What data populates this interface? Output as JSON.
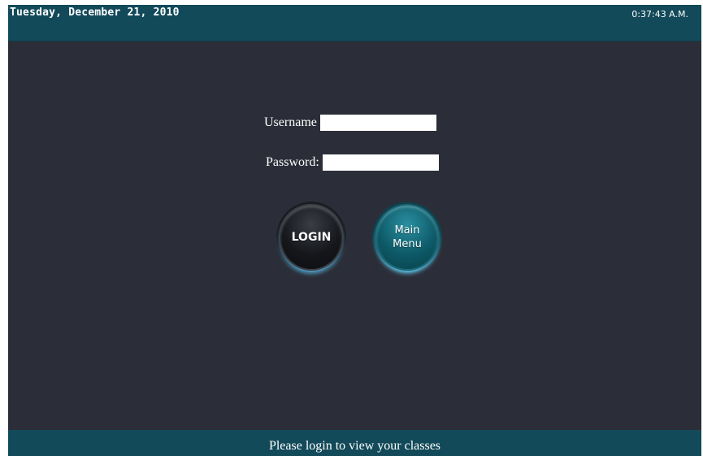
{
  "header": {
    "date": "Tuesday, December 21, 2010",
    "time": "0:37:43 A.M."
  },
  "login_form": {
    "username_label": "Username",
    "username_value": "",
    "password_label": "Password:",
    "password_value": ""
  },
  "buttons": {
    "login_label": "LOGIN",
    "main_menu_line1": "Main",
    "main_menu_line2": "Menu"
  },
  "footer": {
    "status": "Please login to view your classes"
  },
  "colors": {
    "bar_accent": "#134a5a",
    "background": "#2b2e38",
    "button_teal": "#0d5a68",
    "button_dark": "#15171b"
  }
}
